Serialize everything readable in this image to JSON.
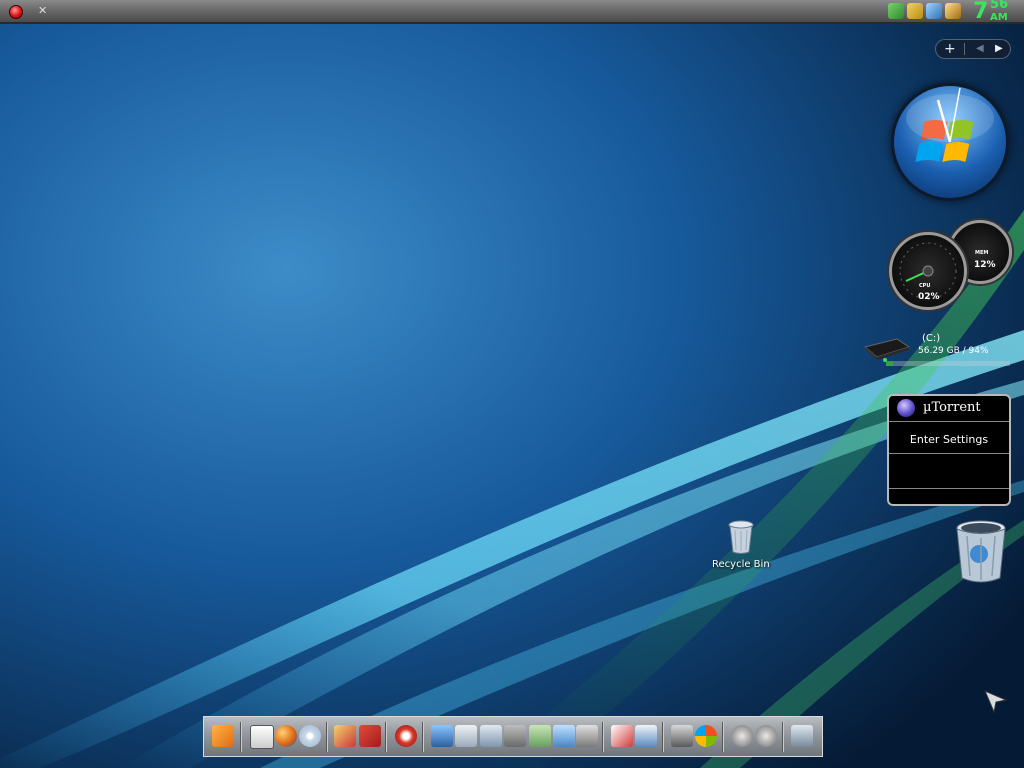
{
  "clock": {
    "hour": "7",
    "minutes": "56",
    "ampm": "AM"
  },
  "sidebar_controls": {
    "add": "+",
    "prev": "◀",
    "next": "▶"
  },
  "gauges": {
    "cpu_label": "CPU",
    "cpu_value": "02%",
    "mem_label": "MEM",
    "mem_value": "12%"
  },
  "drive": {
    "label": "(C:)",
    "info": "56.29 GB / 94%",
    "used_fraction": 0.06
  },
  "utorrent": {
    "title": "µTorrent",
    "settings": "Enter Settings"
  },
  "desktop": {
    "recycle_bin_label": "Recycle Bin"
  },
  "colors": {
    "clock": "#38e65a",
    "sky": "#1a5d9e",
    "streak": "#58d8ff"
  },
  "dock_icons": [
    "media-player-icon",
    "calendar-icon",
    "firefox-icon",
    "dvd-icon",
    "paint-icon",
    "toolbox-icon",
    "ccleaner-icon",
    "computer-icon",
    "documents-icon",
    "notepad-icon",
    "tools-icon",
    "folder-icon",
    "network-icon",
    "calculator-icon",
    "installer-icon",
    "display-icon",
    "settings-icon",
    "windows-icon",
    "power-icon",
    "back-icon",
    "trash-icon"
  ]
}
